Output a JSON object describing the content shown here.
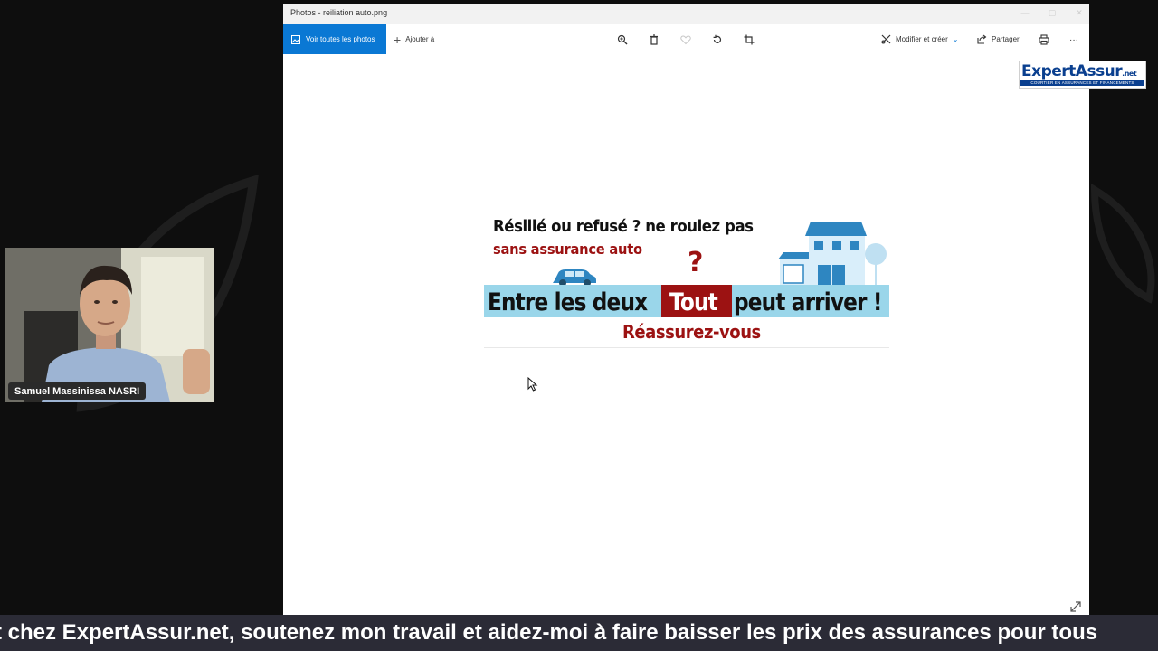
{
  "window": {
    "title": "Photos - reiliation auto.png"
  },
  "toolbar": {
    "view_all_label": "Voir toutes les photos",
    "add_label": "Ajouter à",
    "edit_label": "Modifier et créer",
    "share_label": "Partager",
    "more_label": "···"
  },
  "banner": {
    "line1": "Résilié ou refusé ? ne roulez pas",
    "line2": "sans assurance auto",
    "question_mark": "?",
    "band_left": "Entre les deux",
    "band_highlight": "Tout",
    "band_right": "peut arriver !",
    "bottom": "Réassurez-vous"
  },
  "logo": {
    "name": "ExpertAssur",
    "suffix": ".net",
    "tagline": "COURTIER EN ASSURANCES ET FINANCEMENTS"
  },
  "webcam": {
    "name": "Samuel Massinissa NASRI"
  },
  "ticker": {
    "text": "t chez ExpertAssur.net, soutenez mon travail et aidez-moi à faire baisser les prix des assurances pour tous"
  },
  "colors": {
    "accent_blue": "#0a78d4",
    "banner_red": "#9c1212",
    "banner_band": "#9ad6ea",
    "logo_blue": "#0a3f8f",
    "ticker_bg": "#2b2b36"
  }
}
